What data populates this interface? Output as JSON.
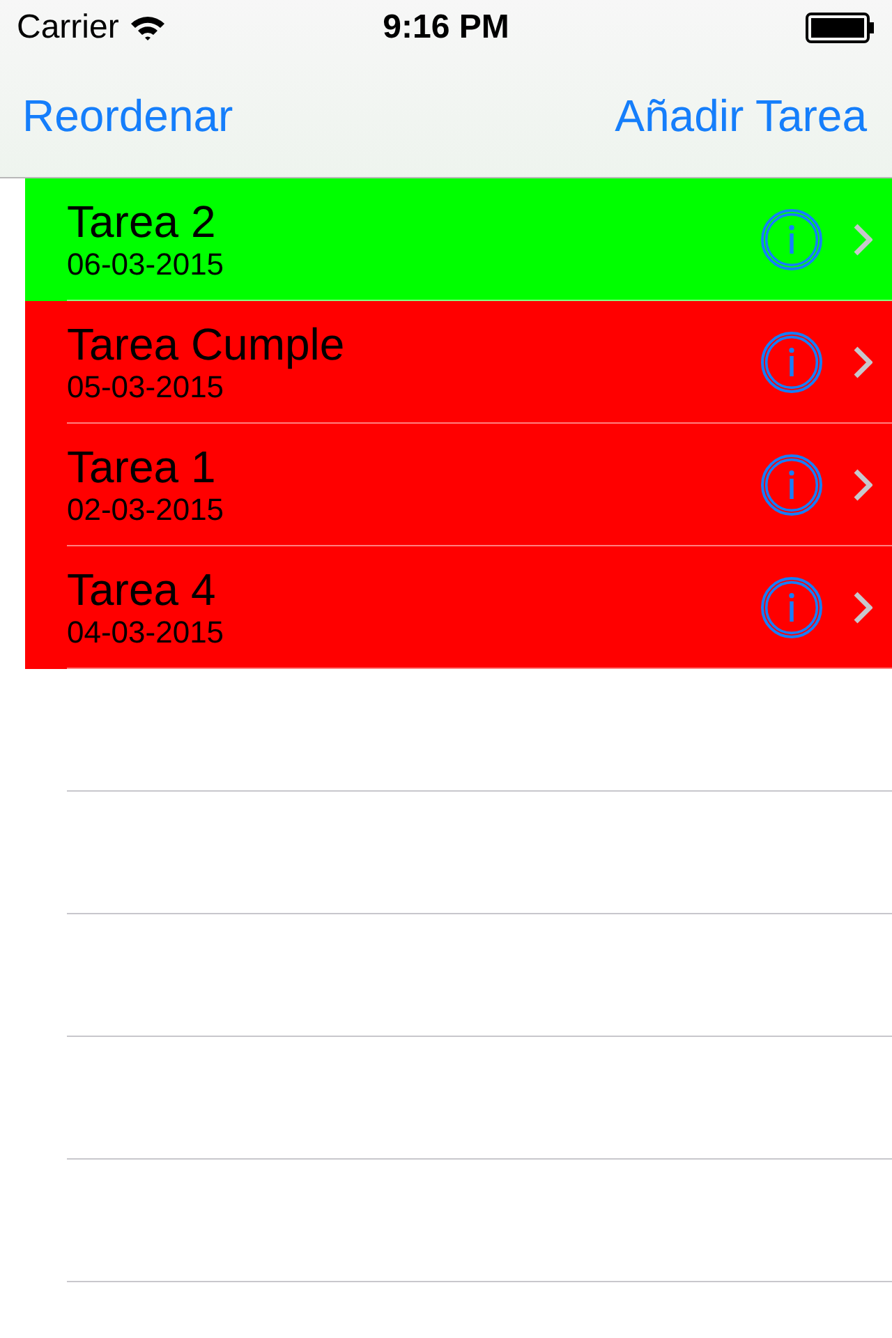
{
  "status_bar": {
    "carrier": "Carrier",
    "time": "9:16 PM"
  },
  "nav_bar": {
    "left_button": "Reordenar",
    "right_button": "Añadir Tarea"
  },
  "tasks": [
    {
      "title": "Tarea 2",
      "date": "06-03-2015",
      "color": "#00ff00"
    },
    {
      "title": "Tarea Cumple",
      "date": "05-03-2015",
      "color": "#ff0000"
    },
    {
      "title": "Tarea 1",
      "date": "02-03-2015",
      "color": "#ff0000"
    },
    {
      "title": "Tarea 4",
      "date": "04-03-2015",
      "color": "#ff0000"
    }
  ]
}
